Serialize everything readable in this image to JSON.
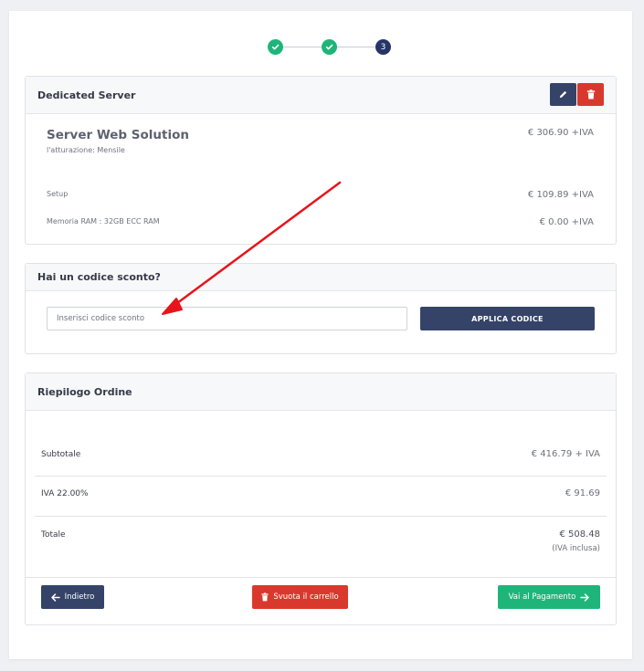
{
  "stepper": {
    "steps": [
      {
        "state": "done"
      },
      {
        "state": "done"
      },
      {
        "state": "current",
        "label": "3"
      }
    ]
  },
  "product_card": {
    "header": "Dedicated Server",
    "product_name": "Server Web Solution",
    "billing": "l'atturazione: Mensile",
    "product_price": "€ 306.90 +IVA",
    "lines": [
      {
        "label": "Setup",
        "price": "€ 109.89 +IVA"
      },
      {
        "label": "Memoria RAM : 32GB ECC RAM",
        "price": "€ 0.00 +IVA"
      }
    ]
  },
  "coupon": {
    "header": "Hai un codice sconto?",
    "placeholder": "Inserisci codice sconto",
    "apply_label": "APPLICA CODICE"
  },
  "summary": {
    "header": "Riepilogo Ordine",
    "subtotal_label": "Subtotale",
    "subtotal_value": "€ 416.79 + IVA",
    "vat_label": "IVA 22.00%",
    "vat_value": "€ 91.69",
    "total_label": "Totale",
    "total_value": "€ 508.48",
    "total_note": "(IVA inclusa)"
  },
  "actions": {
    "back_label": "Indietro",
    "empty_label": "Svuota il carrello",
    "pay_label": "Vai al Pagamento"
  },
  "colors": {
    "primary": "#354368",
    "danger": "#d9392d",
    "success": "#1fb57a",
    "annotation_arrow": "#e8141b"
  },
  "icons": {
    "edit": "pencil-icon",
    "delete": "trash-icon",
    "back": "arrow-left-icon",
    "empty": "trash-icon",
    "pay": "arrow-right-icon",
    "step_done": "check-icon"
  }
}
